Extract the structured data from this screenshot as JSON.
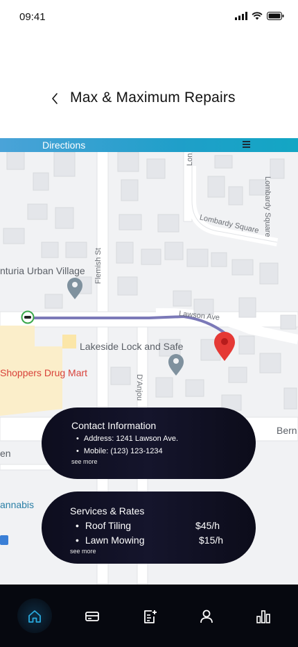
{
  "status": {
    "time": "09:41"
  },
  "header": {
    "title": "Max & Maximum Repairs"
  },
  "map": {
    "directions_label": "Directions",
    "labels": {
      "urban_village": "nturia Urban Village",
      "flemish_st": "Flemish St",
      "lawson_ave": "Lawson Ave",
      "lombardy_square": "Lombardy Square",
      "lombardy_square_partial": "Lombardy Square",
      "lakeside": "Lakeside Lock and Safe",
      "shoppers": "Shoppers Drug Mart",
      "danjou": "D'Anjou",
      "bern": "Bern",
      "en": "en",
      "cannabis": "annabis",
      "lon": "Lon"
    }
  },
  "contact": {
    "title": "Contact Information",
    "address": "Address: 1241 Lawson Ave.",
    "mobile": "Mobile: (123) 123-1234",
    "see_more": "see more"
  },
  "services": {
    "title": "Services & Rates",
    "items": [
      {
        "name": "Roof Tiling",
        "price": "$45/h"
      },
      {
        "name": "Lawn Mowing",
        "price": "$15/h"
      }
    ],
    "see_more": "see more"
  },
  "nav": {
    "items": [
      "home-icon",
      "card-icon",
      "add-note-icon",
      "profile-icon",
      "stats-icon"
    ],
    "accent": "#29a9dd",
    "inactive": "#ffffff"
  },
  "colors": {
    "route": "#7b79b8",
    "pin": "#e53935",
    "directions_bar": "#1f9fc9",
    "card_bg": "#12122a"
  }
}
